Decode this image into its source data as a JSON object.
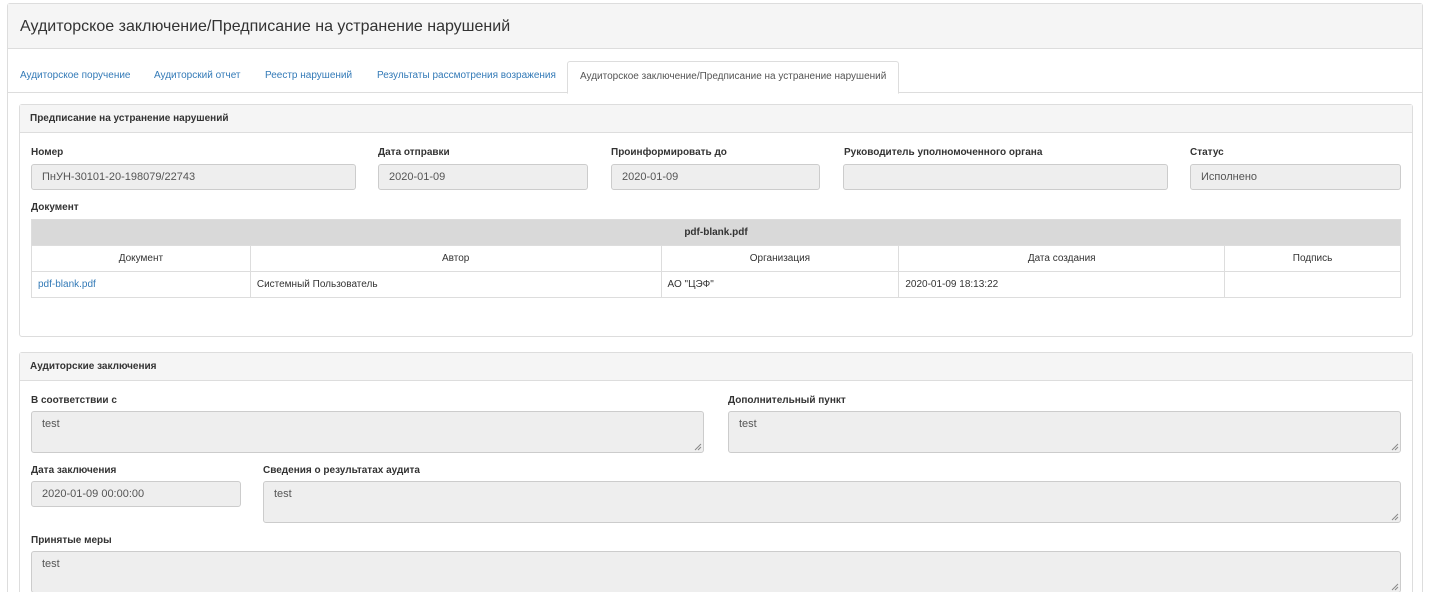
{
  "page": {
    "title": "Аудиторское заключение/Предписание на устранение нарушений"
  },
  "tabs": [
    {
      "label": "Аудиторское поручение"
    },
    {
      "label": "Аудиторский отчет"
    },
    {
      "label": "Реестр нарушений"
    },
    {
      "label": "Результаты рассмотрения возражения"
    },
    {
      "label": "Аудиторское заключение/Предписание на устранение нарушений",
      "active": true
    }
  ],
  "prescription": {
    "heading": "Предписание на устранение нарушений",
    "number_label": "Номер",
    "number_value": "ПнУН-30101-20-198079/22743",
    "send_date_label": "Дата отправки",
    "send_date_value": "2020-01-09",
    "inform_until_label": "Проинформировать до",
    "inform_until_value": "2020-01-09",
    "head_label": "Руководитель уполномоченного органа",
    "head_value": "",
    "status_label": "Статус",
    "status_value": "Исполнено",
    "document_label": "Документ",
    "doc_table": {
      "caption": "pdf-blank.pdf",
      "columns": [
        "Документ",
        "Автор",
        "Организация",
        "Дата создания",
        "Подпись"
      ],
      "rows": [
        {
          "document": "pdf-blank.pdf",
          "author": "Системный Пользователь",
          "org": "АО \"ЦЭФ\"",
          "created": "2020-01-09 18:13:22",
          "signature": ""
        }
      ]
    }
  },
  "conclusions": {
    "heading": "Аудиторские заключения",
    "accordance_label": "В соответствии с",
    "accordance_value": "test",
    "additional_label": "Дополнительный пункт",
    "additional_value": "test",
    "date_label": "Дата заключения",
    "date_value": "2020-01-09 00:00:00",
    "results_label": "Сведения о результатах аудита",
    "results_value": "test",
    "measures_label": "Принятые меры",
    "measures_value": "test"
  }
}
